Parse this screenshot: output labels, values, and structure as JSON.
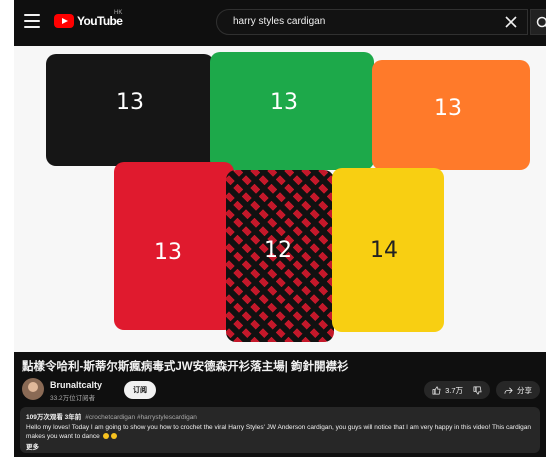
{
  "header": {
    "logo_text": "YouTube",
    "region": "HK",
    "search_value": "harry styles cardigan"
  },
  "video": {
    "swatches": [
      {
        "label": "13",
        "color": "#161616"
      },
      {
        "label": "13",
        "color": "#1da94a"
      },
      {
        "label": "13",
        "color": "#ff7a2a"
      },
      {
        "label": "13",
        "color": "#e01a2e"
      },
      {
        "label": "12",
        "color": "#c4182a"
      },
      {
        "label": "14",
        "color": "#f8cf12"
      }
    ]
  },
  "title": "點樣令哈利-斯蒂尔斯瘋病毒式JW安德森开衫落主場| 鉤針開襟衫",
  "channel": {
    "name": "Brunaltcalty",
    "subscribers": "33.2万位订阅者",
    "subscribe_label": "订阅"
  },
  "actions": {
    "like_count": "3.7万",
    "share_label": "分享"
  },
  "description": {
    "views_date": "109万次观看 3年前",
    "tags": "#crochetcardigan #harrystylescardigan",
    "text": "Hello my loves! Today I am going to show you how to crochet the viral Harry Styles' JW Anderson cardigan, you guys will notice that I am very happy in this video! This cardigan makes you want to dance",
    "more_label": "更多"
  },
  "colors": {
    "background": "#0f0f0f",
    "accent": "#ff0000"
  }
}
